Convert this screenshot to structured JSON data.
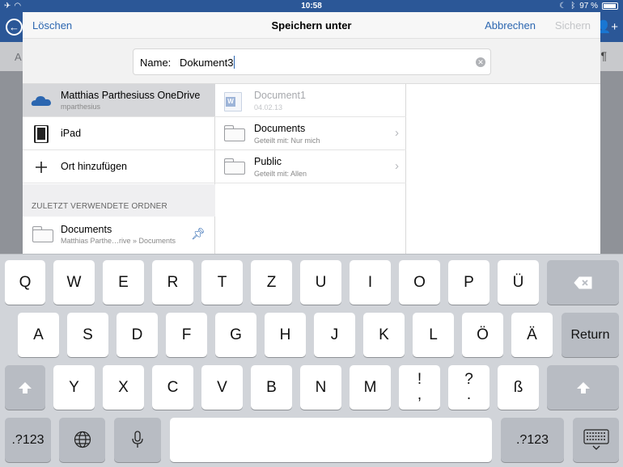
{
  "status_bar": {
    "time": "10:58",
    "battery": "97 %"
  },
  "app_bar": {
    "ribbon_left": "A"
  },
  "dialog": {
    "delete_label": "Löschen",
    "title": "Speichern unter",
    "cancel_label": "Abbrechen",
    "save_label": "Sichern",
    "name_label": "Name:",
    "name_value": "Dokument3"
  },
  "locations": [
    {
      "title": "Matthias Parthesiuss OneDrive",
      "subtitle": "mparthesius",
      "icon": "onedrive-cloud-icon",
      "selected": true
    },
    {
      "title": "iPad",
      "icon": "ipad-icon"
    },
    {
      "title": "Ort hinzufügen",
      "icon": "plus-icon"
    }
  ],
  "recent": {
    "header": "ZULETZT VERWENDETE ORDNER",
    "items": [
      {
        "title": "Documents",
        "subtitle": "Matthias Parthe…rive » Documents",
        "icon": "folder-icon"
      }
    ]
  },
  "files": [
    {
      "title": "Document1",
      "subtitle": "04.02.13",
      "icon": "word-document-icon",
      "dimmed": true
    },
    {
      "title": "Documents",
      "subtitle": "Geteilt mit: Nur mich",
      "icon": "folder-icon"
    },
    {
      "title": "Public",
      "subtitle": "Geteilt mit: Allen",
      "icon": "folder-icon"
    }
  ],
  "keyboard": {
    "row1": [
      "Q",
      "W",
      "E",
      "R",
      "T",
      "Z",
      "U",
      "I",
      "O",
      "P",
      "Ü"
    ],
    "row2": [
      "A",
      "S",
      "D",
      "F",
      "G",
      "H",
      "J",
      "K",
      "L",
      "Ö",
      "Ä"
    ],
    "return_label": "Return",
    "row3": [
      "Y",
      "X",
      "C",
      "V",
      "B",
      "N",
      "M"
    ],
    "punct1": {
      "top": "!",
      "bottom": ","
    },
    "punct2": {
      "top": "?",
      "bottom": "."
    },
    "sharp_s": "ß",
    "numbers_label": ".?123"
  },
  "colors": {
    "accent": "#2b66b0",
    "app_bar": "#2b5797"
  }
}
